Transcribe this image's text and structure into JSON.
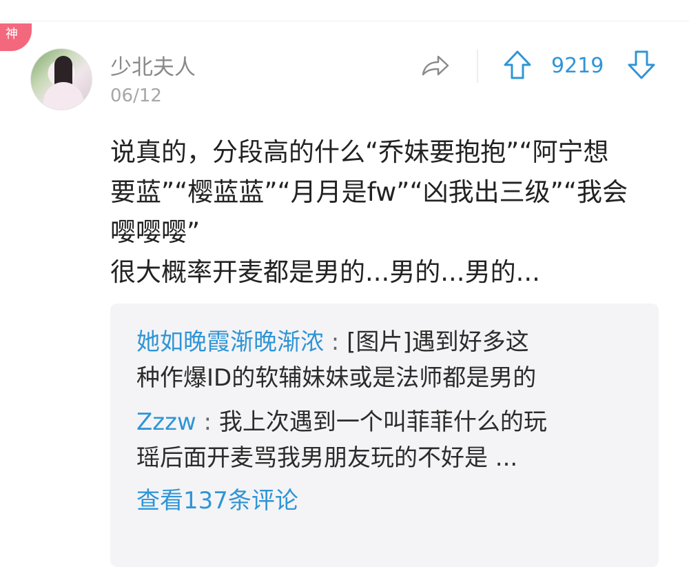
{
  "badge": "神",
  "post": {
    "username": "少北夫人",
    "date": "06/12",
    "vote_count": "9219",
    "body_lines": [
      "说真的，分段高的什么“乔妹要抱抱”“阿宁想",
      "要蓝”“樱蓝蓝”“月月是fw”“凶我出三级”“我会",
      "嘤嘤嘤”",
      "很大概率开麦都是男的...男的...男的..."
    ]
  },
  "comments": [
    {
      "author": "她如晚霞渐晚渐浓",
      "separator": " : ",
      "text_line1": "[图片]遇到好多这",
      "text_line2": "种作爆ID的软辅妹妹或是法师都是男的"
    },
    {
      "author": "Zzzw",
      "separator": " : ",
      "text_line1": "我上次遇到一个叫菲菲什么的玩",
      "text_line2": "瑶后面开麦骂我男朋友玩的不好是 ..."
    }
  ],
  "view_more": "查看137条评论",
  "icons": {
    "share": "share-arrow-icon",
    "upvote": "arrow-up-icon",
    "downvote": "arrow-down-icon"
  },
  "colors": {
    "accent": "#2f95d6",
    "badge": "#f4687d",
    "muted": "#8a8a8a"
  }
}
